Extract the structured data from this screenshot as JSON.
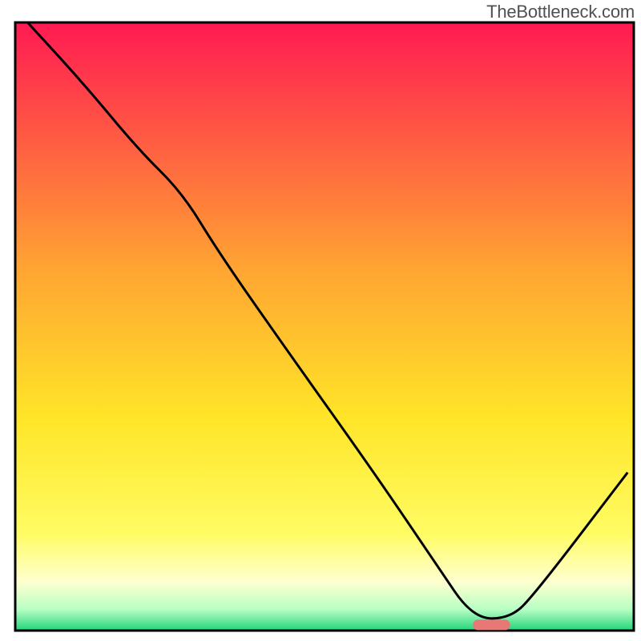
{
  "watermark": "TheBottleneck.com",
  "chart_data": {
    "type": "line",
    "title": "",
    "xlabel": "",
    "ylabel": "",
    "xlim": [
      0,
      100
    ],
    "ylim": [
      0,
      100
    ],
    "grid": false,
    "legend": false,
    "background_gradient": [
      {
        "pos": 0.0,
        "color": "#ff1a52"
      },
      {
        "pos": 0.41,
        "color": "#ffa632"
      },
      {
        "pos": 0.65,
        "color": "#ffe528"
      },
      {
        "pos": 0.84,
        "color": "#fffc63"
      },
      {
        "pos": 0.92,
        "color": "#ffffd0"
      },
      {
        "pos": 0.965,
        "color": "#b8ffc4"
      },
      {
        "pos": 1.0,
        "color": "#22d37a"
      }
    ],
    "series": [
      {
        "name": "bottleneck-curve",
        "color": "#000000",
        "x": [
          2,
          11,
          20,
          27,
          33,
          44,
          58,
          68,
          74,
          80,
          84,
          99
        ],
        "y": [
          100,
          90,
          79,
          72,
          62,
          46,
          26,
          11,
          2,
          2,
          6,
          26
        ]
      }
    ],
    "marker": {
      "name": "optimal-zone",
      "x_center": 77,
      "y": 1,
      "width": 6,
      "color": "#e87876"
    },
    "frame_color": "#000000"
  }
}
